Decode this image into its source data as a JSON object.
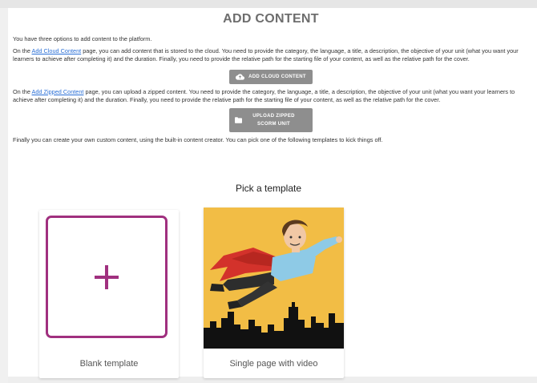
{
  "page": {
    "title": "ADD CONTENT",
    "intro": "You have three options to add content to the platform."
  },
  "cloud": {
    "pre": "On the ",
    "link": "Add Cloud Content",
    "post": " page, you can add content that is stored to the cloud. You need to provide the category, the language, a title, a description, the objective of your unit (what you want your learners to achieve after completing it) and the duration. Finally, you need to provide the relative path for the starting file of your content, as well as the relative path for the cover.",
    "button_label": "ADD CLOUD CONTENT",
    "button_icon": "cloud-upload-icon"
  },
  "zipped": {
    "pre": "On the ",
    "link": "Add Zipped Content",
    "post": " page, you can upload a zipped content. You need to provide the category, the language, a title, a description, the objective of your unit (what you want your learners to achieve after completing it) and the duration. Finally, you need to provide the relative path for the starting file of your content, as well as the relative path for the cover.",
    "button_line1": "UPLOAD ZIPPED",
    "button_line2": "SCORM UNIT",
    "button_icon": "folder-icon"
  },
  "custom": {
    "text": "Finally you can create your own custom content, using the built-in content creator. You can pick one of the following templates to kick things off."
  },
  "templates": {
    "heading": "Pick a template",
    "items": [
      {
        "label": "Blank template",
        "icon": "plus-icon"
      },
      {
        "label": "Single page with video",
        "image": "superhero-flying-over-city"
      }
    ]
  },
  "colors": {
    "accent": "#a0307f",
    "button": "#8e8e8e",
    "link": "#2a6fd6",
    "hero_bg": "#f2bd45"
  }
}
